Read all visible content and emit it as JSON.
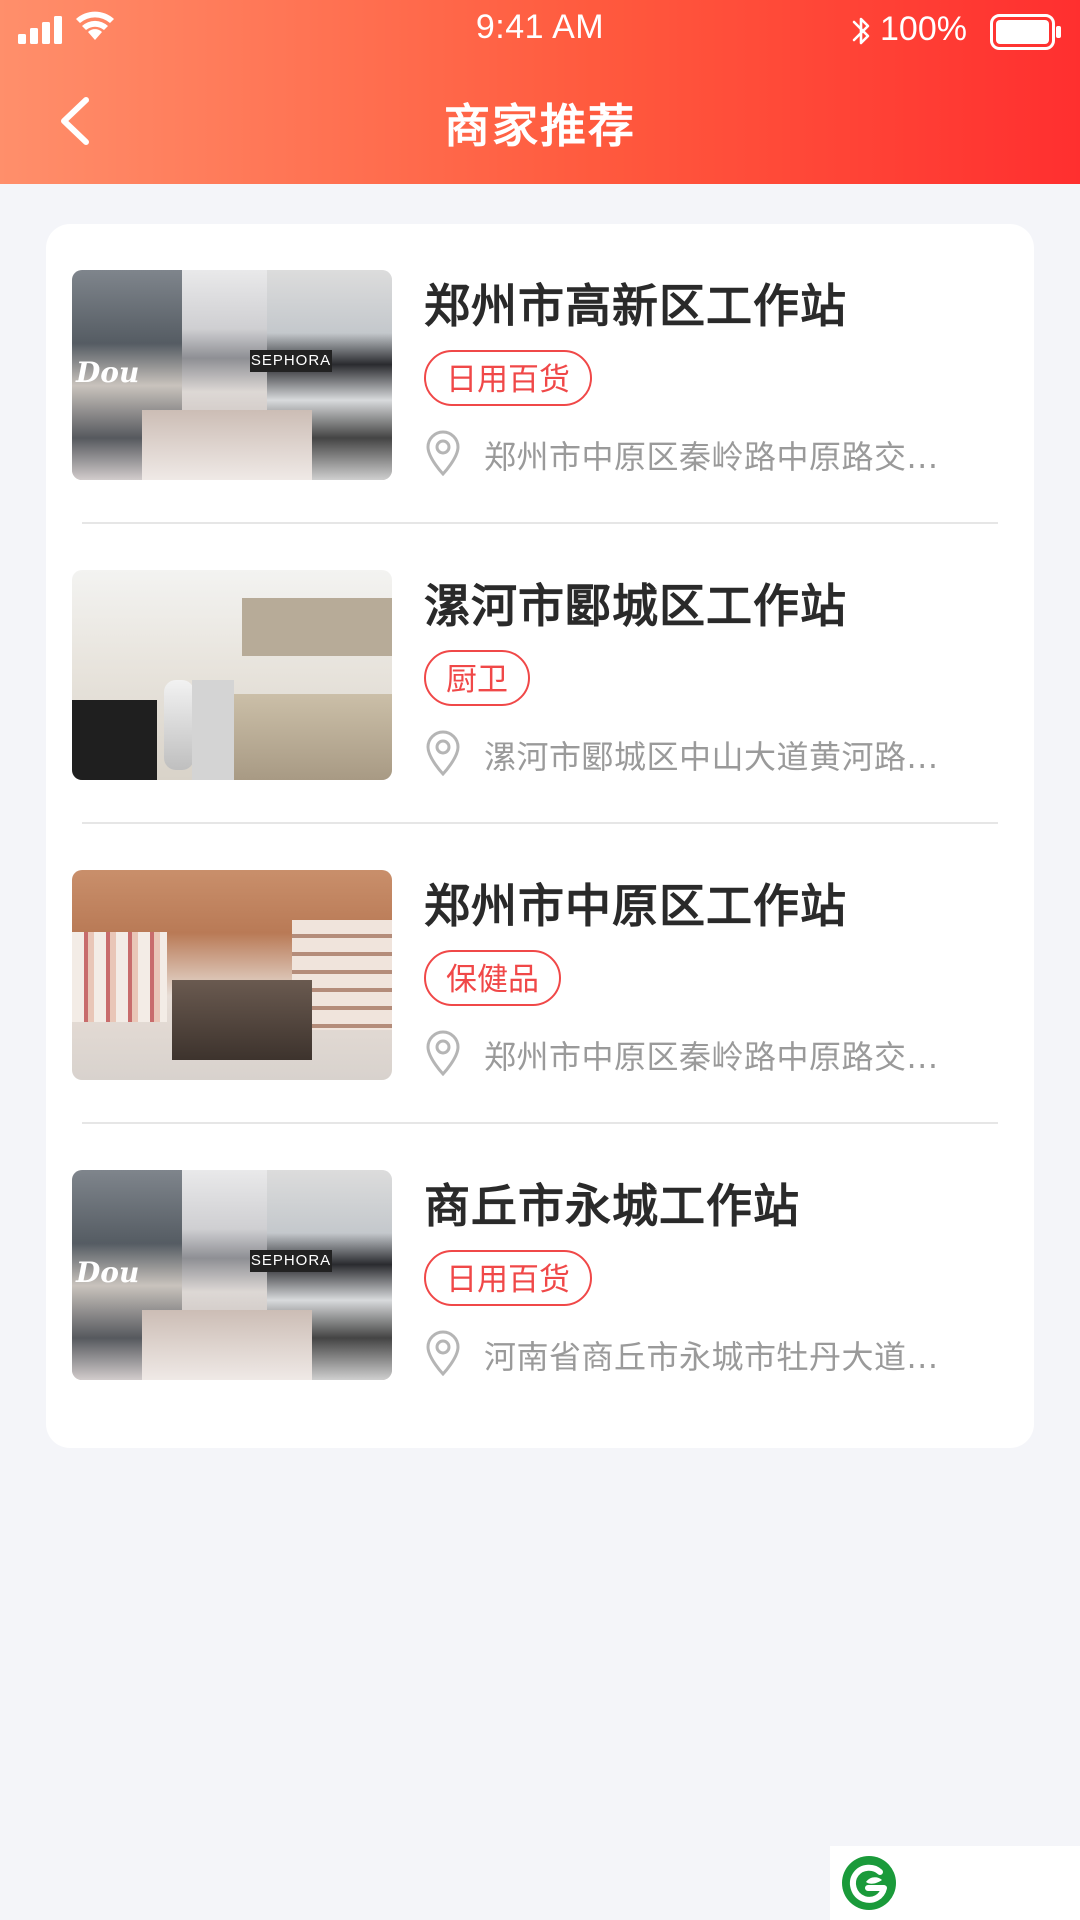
{
  "status_bar": {
    "time": "9:41 AM",
    "battery_percent": "100%"
  },
  "nav": {
    "title": "商家推荐"
  },
  "merchants": [
    {
      "name": "郑州市高新区工作站",
      "tag": "日用百货",
      "address": "郑州市中原区秦岭路中原路交...",
      "image": "mall-interior"
    },
    {
      "name": "漯河市郾城区工作站",
      "tag": "厨卫",
      "address": "漯河市郾城区中山大道黄河路...",
      "image": "kitchen-showroom"
    },
    {
      "name": "郑州市中原区工作站",
      "tag": "保健品",
      "address": "郑州市中原区秦岭路中原路交...",
      "image": "retail-store"
    },
    {
      "name": "商丘市永城工作站",
      "tag": "日用百货",
      "address": "河南省商丘市永城市牡丹大道...",
      "image": "mall-interior"
    }
  ],
  "colors": {
    "header_gradient_start": "#ff8f6b",
    "header_gradient_end": "#ff2f2f",
    "tag_red": "#f04848",
    "logo_green": "#1a9a3a"
  }
}
